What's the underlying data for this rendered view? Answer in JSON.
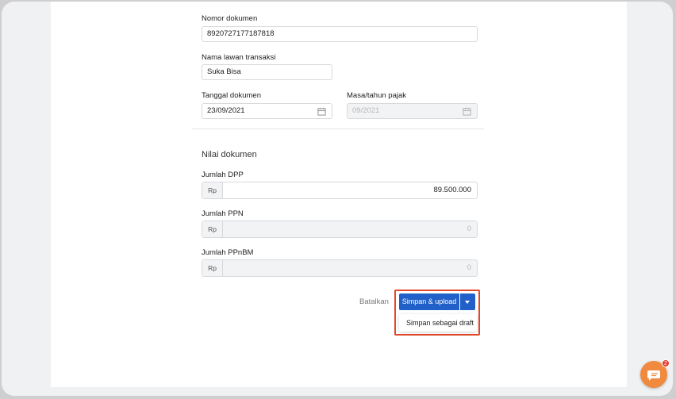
{
  "form": {
    "doc_number": {
      "label": "Nomor dokumen",
      "value": "8920727177187818"
    },
    "counterparty": {
      "label": "Nama lawan transaksi",
      "value": "Suka Bisa"
    },
    "doc_date": {
      "label": "Tanggal dokumen",
      "value": "23/09/2021"
    },
    "tax_period": {
      "label": "Masa/tahun pajak",
      "value": "09/2021"
    }
  },
  "values": {
    "section_title": "Nilai dokumen",
    "dpp": {
      "label": "Jumlah DPP",
      "prefix": "Rp",
      "value": "89.500.000"
    },
    "ppn": {
      "label": "Jumlah PPN",
      "prefix": "Rp",
      "value": "0"
    },
    "ppnbm": {
      "label": "Jumlah PPnBM",
      "prefix": "Rp",
      "value": "0"
    }
  },
  "actions": {
    "cancel_label": "Batalkan",
    "save_upload_label": "Simpan & upload",
    "save_draft_label": "Simpan sebagai draft"
  },
  "chat": {
    "icon": "chat-icon",
    "badge_count": "2"
  },
  "colors": {
    "primary": "#2060c8",
    "highlight": "#e04a2a",
    "chat": "#f08a3e"
  }
}
